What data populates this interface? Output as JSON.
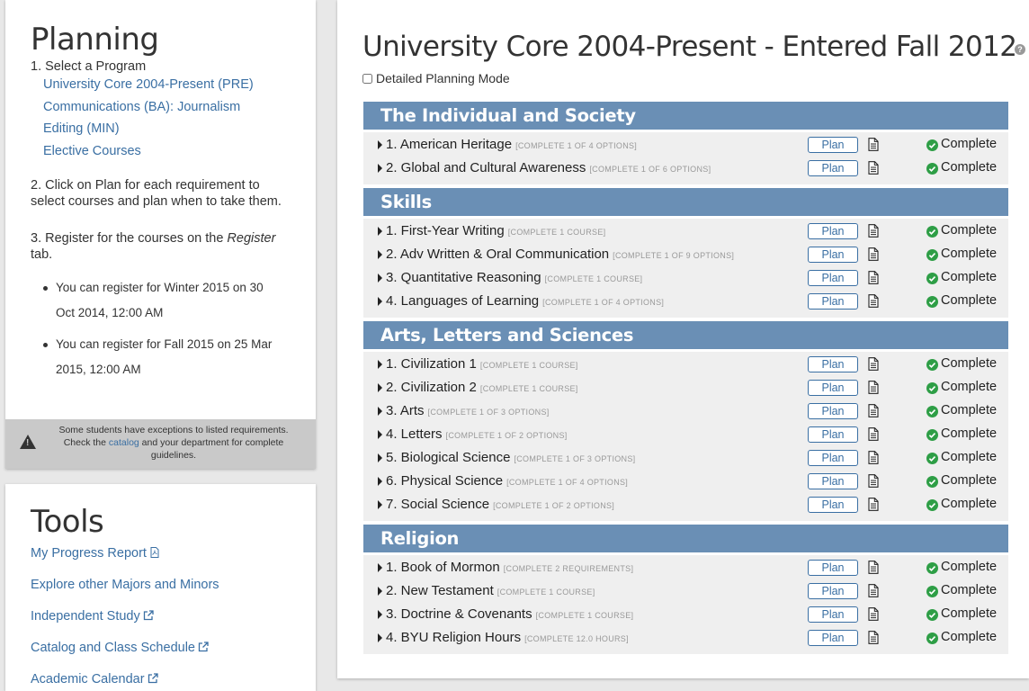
{
  "planning": {
    "title": "Planning",
    "step1": "1. Select a Program",
    "programs": [
      "University Core 2004-Present (PRE)",
      "Communications (BA): Journalism",
      "Editing (MIN)",
      "Elective Courses"
    ],
    "step2_line1": "2. Click on Plan for each requirement to",
    "step2_line2": "select courses and plan when to take them.",
    "step3_prefix": "3. Register for the courses on the ",
    "step3_italic": "Register",
    "step3_line2": "tab.",
    "register_notes": [
      {
        "line1": "You can register for Winter 2015 on 30",
        "line2": "Oct 2014, 12:00 AM"
      },
      {
        "line1": "You can register for Fall 2015 on 25 Mar",
        "line2": "2015, 12:00 AM"
      }
    ],
    "exception_line1": "Some students have exceptions to listed requirements.",
    "exception_line2_pre": "Check the ",
    "exception_link": "catalog",
    "exception_line2_post": " and your department for complete",
    "exception_line3": "guidelines."
  },
  "tools": {
    "title": "Tools",
    "links": [
      {
        "label": "My Progress Report",
        "icon": "pdf-icon"
      },
      {
        "label": "Explore other Majors and Minors",
        "icon": ""
      },
      {
        "label": "Independent Study",
        "icon": "external-link-icon"
      },
      {
        "label": "Catalog and Class Schedule",
        "icon": "external-link-icon"
      },
      {
        "label": "Academic Calendar",
        "icon": "external-link-icon"
      }
    ]
  },
  "main": {
    "title": "University Core 2004-Present - Entered Fall 2012",
    "help": "?",
    "detailed_mode_label": "Detailed Planning Mode",
    "plan_label": "Plan",
    "status_label": "Complete",
    "sections": [
      {
        "title": "The Individual and Society",
        "requirements": [
          {
            "name": "1. American Heritage",
            "hint": "[COMPLETE 1 OF 4 OPTIONS]"
          },
          {
            "name": "2. Global and Cultural Awareness",
            "hint": "[COMPLETE 1 OF 6 OPTIONS]"
          }
        ]
      },
      {
        "title": "Skills",
        "requirements": [
          {
            "name": "1. First-Year Writing",
            "hint": "[COMPLETE 1 COURSE]"
          },
          {
            "name": "2. Adv Written & Oral Communication",
            "hint": "[COMPLETE 1 OF 9 OPTIONS]"
          },
          {
            "name": "3. Quantitative Reasoning",
            "hint": "[COMPLETE 1 COURSE]"
          },
          {
            "name": "4. Languages of Learning",
            "hint": "[COMPLETE 1 OF 4 OPTIONS]"
          }
        ]
      },
      {
        "title": "Arts, Letters and Sciences",
        "requirements": [
          {
            "name": "1. Civilization 1",
            "hint": "[COMPLETE 1 COURSE]"
          },
          {
            "name": "2. Civilization 2",
            "hint": "[COMPLETE 1 COURSE]"
          },
          {
            "name": "3. Arts",
            "hint": "[COMPLETE 1 OF 3 OPTIONS]"
          },
          {
            "name": "4. Letters",
            "hint": "[COMPLETE 1 OF 2 OPTIONS]"
          },
          {
            "name": "5. Biological Science",
            "hint": "[COMPLETE 1 OF 3 OPTIONS]"
          },
          {
            "name": "6. Physical Science",
            "hint": "[COMPLETE 1 OF 4 OPTIONS]"
          },
          {
            "name": "7. Social Science",
            "hint": "[COMPLETE 1 OF 2 OPTIONS]"
          }
        ]
      },
      {
        "title": "Religion",
        "requirements": [
          {
            "name": "1. Book of Mormon",
            "hint": "[COMPLETE 2 REQUIREMENTS]"
          },
          {
            "name": "2. New Testament",
            "hint": "[COMPLETE 1 COURSE]"
          },
          {
            "name": "3. Doctrine & Covenants",
            "hint": "[COMPLETE 1 COURSE]"
          },
          {
            "name": "4. BYU Religion Hours",
            "hint": "[COMPLETE 12.0 HOURS]"
          }
        ]
      }
    ]
  },
  "colors": {
    "section_header": "#6a8fb5",
    "link": "#3a6fa3",
    "complete_check": "#2e9e46"
  }
}
